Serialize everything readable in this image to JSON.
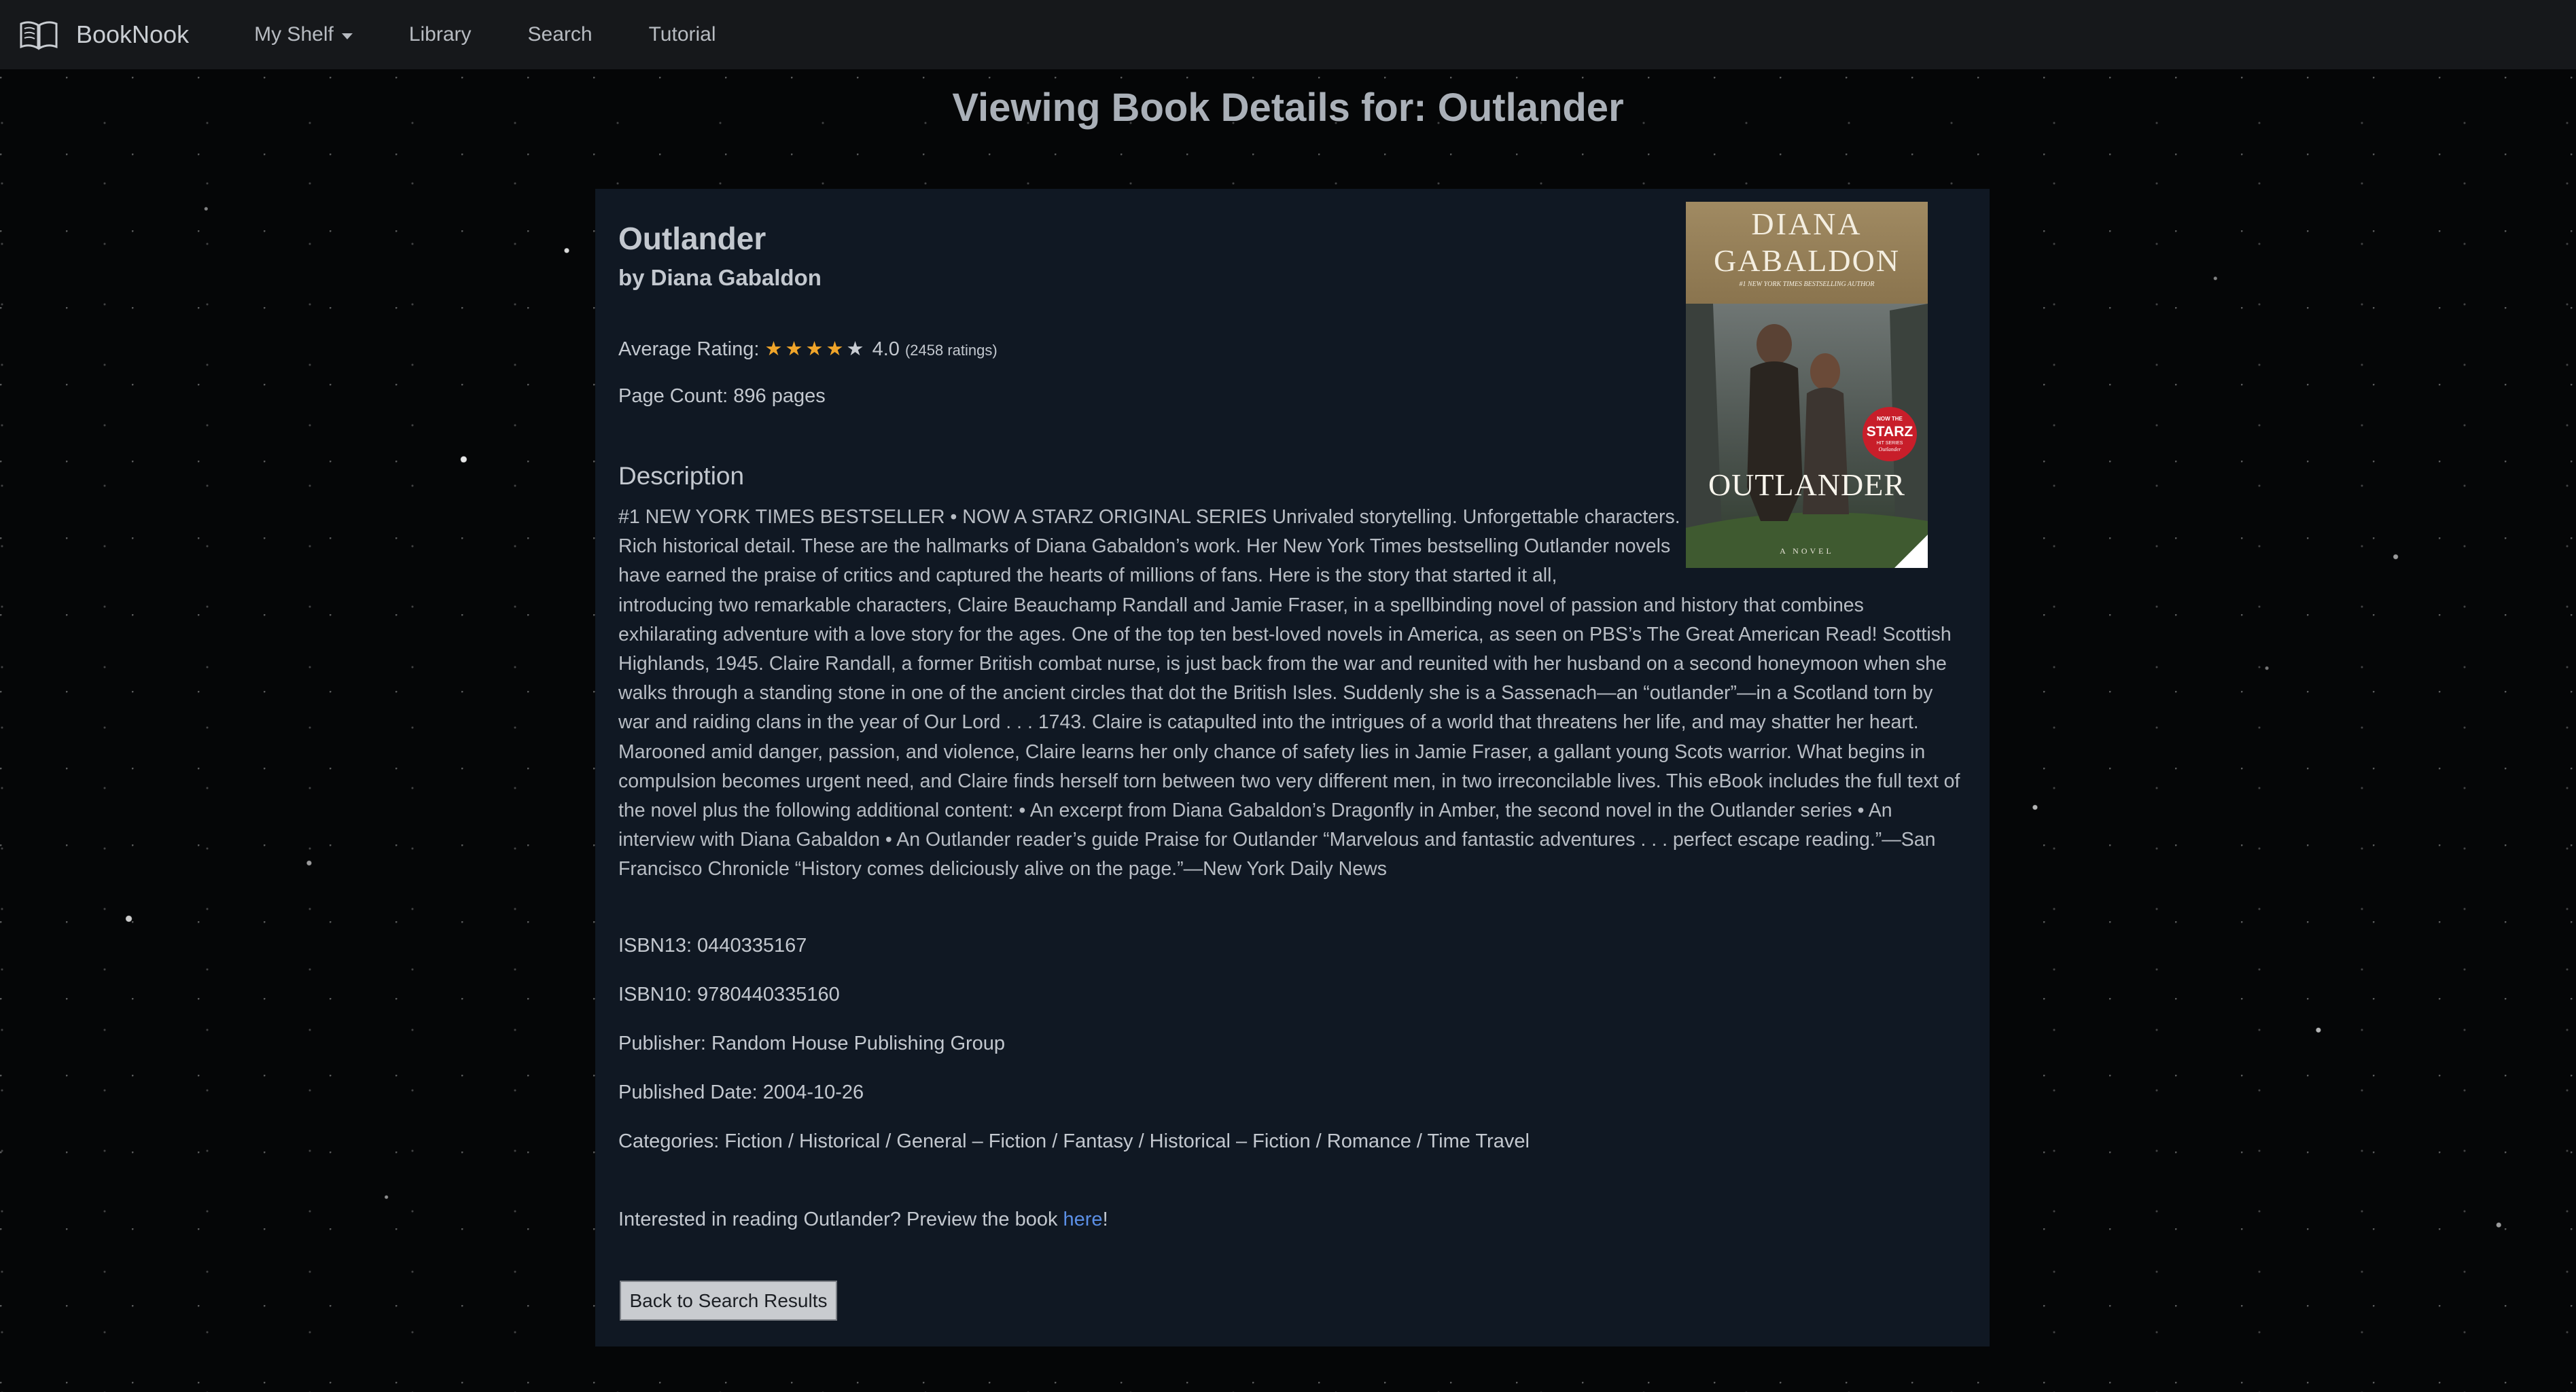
{
  "nav": {
    "brand": "BookNook",
    "items": [
      "My Shelf",
      "Library",
      "Search",
      "Tutorial"
    ]
  },
  "page": {
    "title": "Viewing Book Details for: Outlander"
  },
  "book": {
    "title": "Outlander",
    "author_line": "by Diana Gabaldon",
    "rating_label": "Average Rating:",
    "rating_value": "4.0",
    "rating_count": "(2458 ratings)",
    "stars_filled": 4,
    "stars_total": 5,
    "page_count": "Page Count: 896 pages",
    "description_heading": "Description",
    "description_lines": [
      "#1 NEW YORK TIMES BESTSELLER • NOW A STARZ ORIGINAL SERIES  Unrivaled storytelling. Unforgettable characters.",
      "Rich historical detail. These are the hallmarks of Diana Gabaldon’s work. Her New York Times bestselling Outlander novels",
      "have earned the praise of critics and captured the hearts of millions of fans. Here is the story that started it all,",
      "introducing two remarkable characters, Claire Beauchamp Randall and Jamie Fraser, in a spellbinding novel of passion and history that combines"
    ],
    "description_rest": "exhilarating adventure with a love story for the ages. One of the top ten best-loved novels in America, as seen on PBS’s The Great American Read! Scottish Highlands, 1945. Claire Randall, a former British combat nurse, is just back from the war and reunited with her husband on a second honeymoon when she walks through a standing stone in one of the ancient circles that dot the British Isles. Suddenly she is a Sassenach—an “outlander”—in a Scotland torn by war and raiding clans in the year of Our Lord . . . 1743. Claire is catapulted into the intrigues of a world that threatens her life, and may shatter her heart. Marooned amid danger, passion, and violence, Claire learns her only chance of safety lies in Jamie Fraser, a gallant young Scots warrior. What begins in compulsion becomes urgent need, and Claire finds herself torn between two very different men, in two irreconcilable lives. This eBook includes the full text of the novel plus the following additional content: • An excerpt from Diana Gabaldon’s Dragonfly in Amber, the second novel in the Outlander series  • An interview with Diana Gabaldon  • An Outlander reader’s guide Praise for Outlander “Marvelous and fantastic adventures . . . perfect escape reading.”—San Francisco Chronicle “History comes deliciously alive on the page.”—New York Daily News",
    "isbn13": "ISBN13: 0440335167",
    "isbn10": "ISBN10: 9780440335160",
    "publisher": "Publisher: Random House Publishing Group",
    "published_date": "Published Date: 2004-10-26",
    "categories": "Categories: Fiction / Historical / General – Fiction / Fantasy / Historical – Fiction / Romance / Time Travel",
    "preview_prefix": "Interested in reading Outlander? Preview the book ",
    "preview_link": "here",
    "preview_suffix": "!",
    "back_button": "Back to Search Results",
    "cover": {
      "author_line1": "DIANA",
      "author_line2": "GABALDON",
      "tagline": "#1 NEW YORK TIMES BESTSELLING AUTHOR",
      "badge_line1": "NOW THE",
      "badge_line2": "STARZ",
      "badge_line3": "HIT SERIES",
      "badge_line4": "Outlander",
      "title": "OUTLANDER",
      "subtitle": "A NOVEL"
    }
  },
  "colors": {
    "navbar": "#16181b",
    "card": "#101823",
    "star": "#f0a52a",
    "link": "#5b8fe6",
    "button": "#c9ccd0"
  }
}
